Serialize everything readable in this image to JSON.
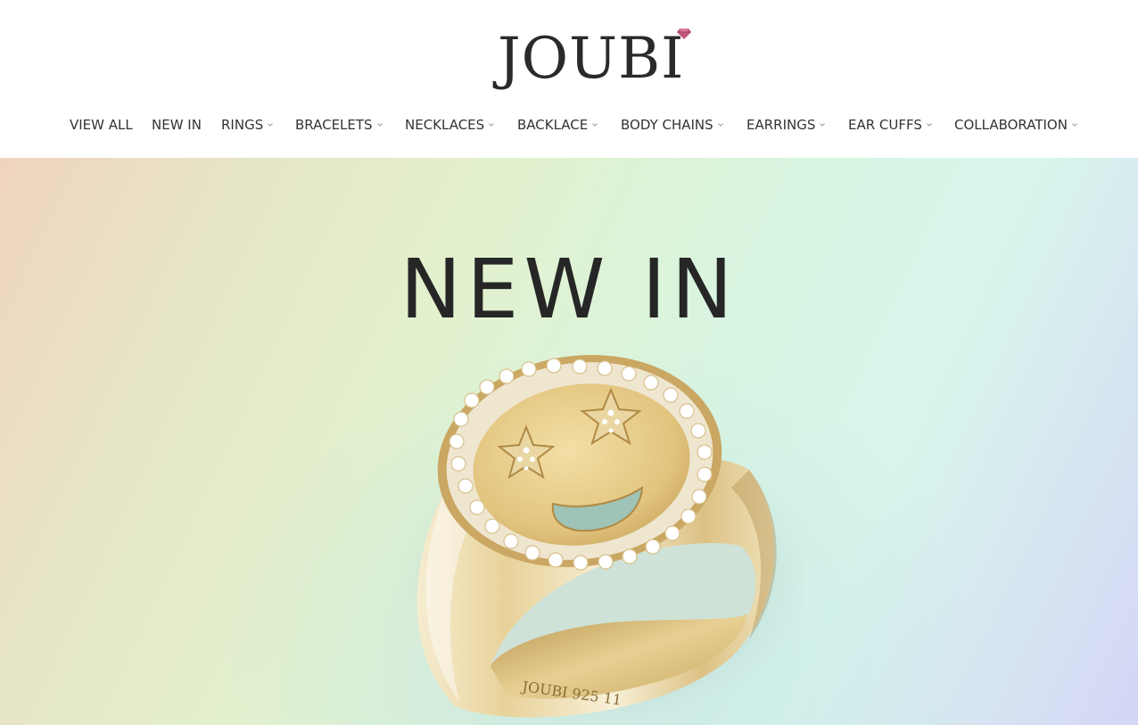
{
  "brand": {
    "logo_text": "JOUBI",
    "logo_icon": "gem-icon",
    "gem_color": "#c2577a"
  },
  "nav": {
    "items": [
      {
        "label": "VIEW ALL",
        "has_dropdown": false
      },
      {
        "label": "NEW IN",
        "has_dropdown": false
      },
      {
        "label": "RINGS",
        "has_dropdown": true
      },
      {
        "label": "BRACELETS",
        "has_dropdown": true
      },
      {
        "label": "NECKLACES",
        "has_dropdown": true
      },
      {
        "label": "BACKLACE",
        "has_dropdown": true
      },
      {
        "label": "BODY CHAINS",
        "has_dropdown": true
      },
      {
        "label": "EARRINGS",
        "has_dropdown": true
      },
      {
        "label": "EAR CUFFS",
        "has_dropdown": true
      },
      {
        "label": "COLLABORATION",
        "has_dropdown": true
      }
    ],
    "dropdown_icon": "chevron-down-icon"
  },
  "hero": {
    "title": "NEW IN",
    "image": {
      "subject": "gold-signet-ring-with-star-eyes-smiley-face-and-diamond-halo",
      "engraving": "JOUBI 925 11"
    }
  },
  "colors": {
    "text": "#333333",
    "gold": "#e2c889"
  }
}
